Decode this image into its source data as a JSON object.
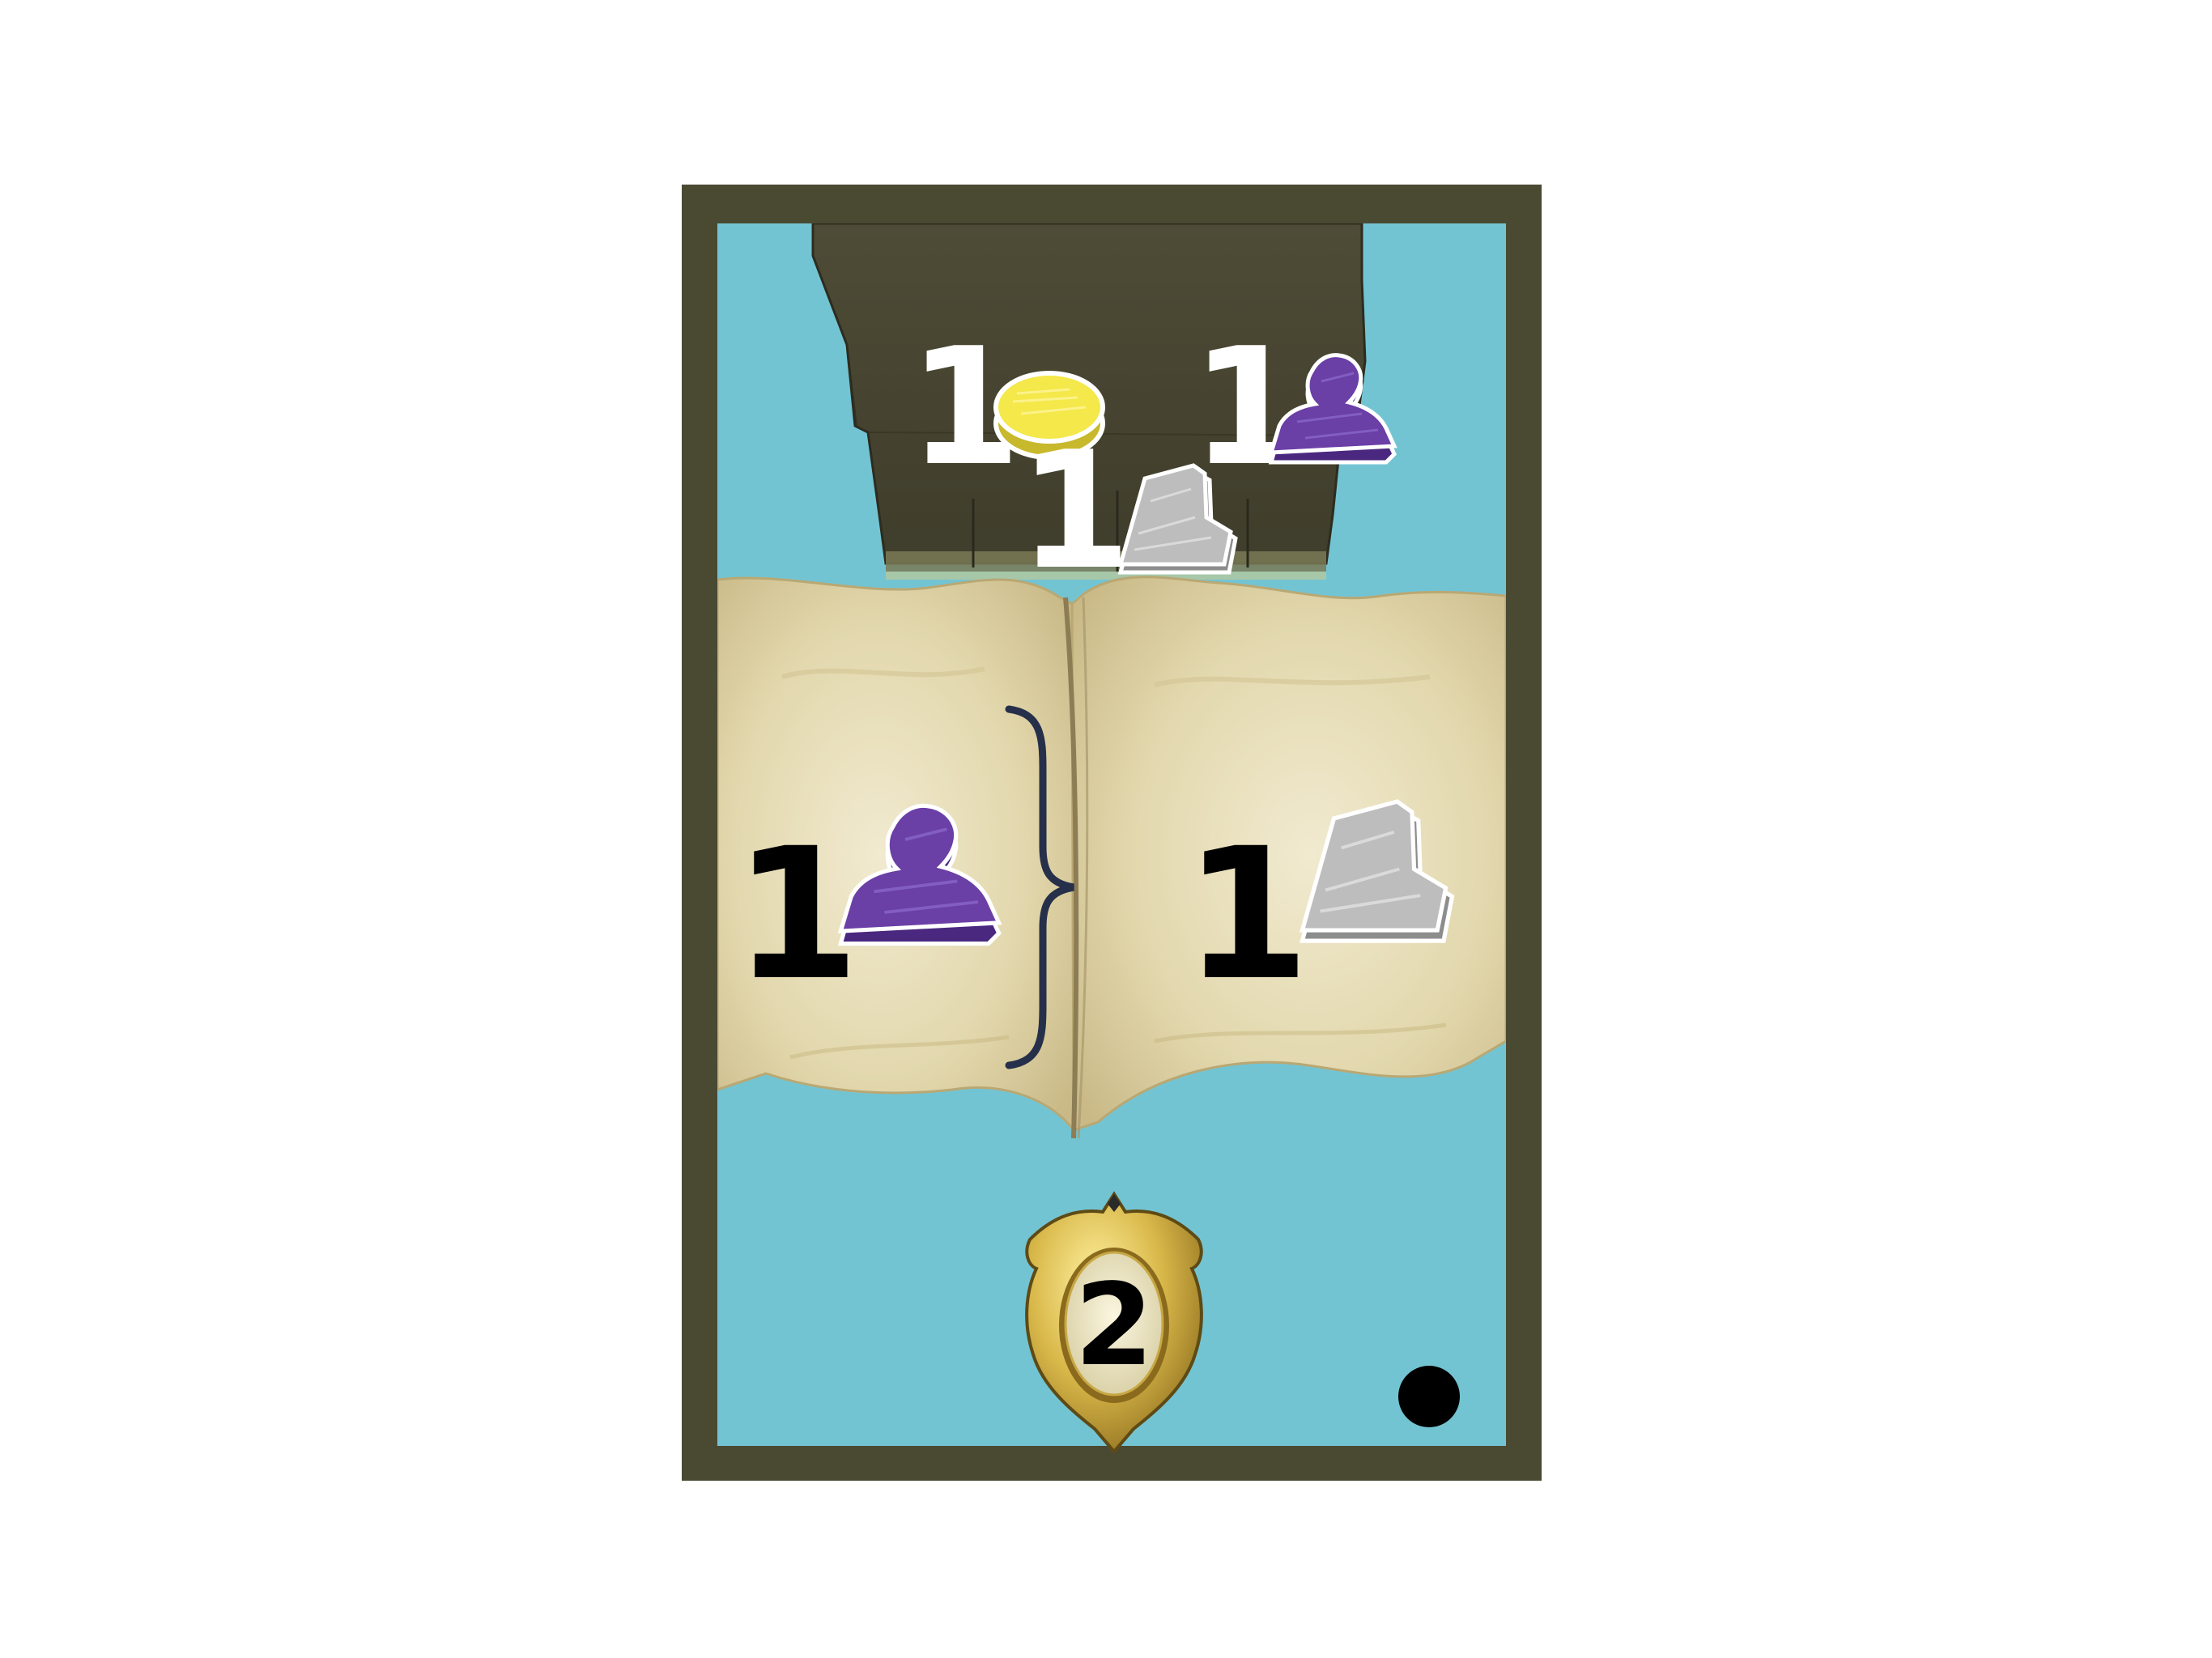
{
  "card": {
    "cost": {
      "row1": [
        {
          "amount": "1",
          "resource": "gold-coin-icon"
        },
        {
          "amount": "1",
          "resource": "purple-worker-meeple-icon"
        }
      ],
      "row2": [
        {
          "amount": "1",
          "resource": "stone-icon"
        }
      ]
    },
    "exchange": {
      "give": {
        "amount": "1",
        "resource": "purple-worker-meeple-icon"
      },
      "receive": {
        "amount": "1",
        "resource": "stone-icon"
      }
    },
    "victory_points": "2",
    "pip_count": 1
  },
  "colors": {
    "card_frame": "#4a4a33",
    "card_background": "#73c4d3",
    "plinth": "#4a4833",
    "parchment": "#e6dcb2",
    "gold": "#f4e84a",
    "worker_purple": "#6a3fa6",
    "stone_grey": "#b8b8b8",
    "badge_gold": "#d9b84a"
  }
}
